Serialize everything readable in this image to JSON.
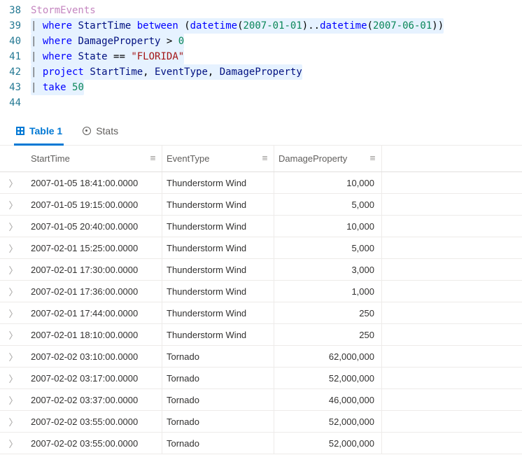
{
  "editor": {
    "lines": [
      {
        "num": 38,
        "highlight": false,
        "tokens": [
          {
            "t": "StormEvents",
            "c": "tk-src"
          }
        ]
      },
      {
        "num": 39,
        "highlight": true,
        "tokens": [
          {
            "t": "| ",
            "c": "tk-pipe"
          },
          {
            "t": "where",
            "c": "tk-op"
          },
          {
            "t": " ",
            "c": ""
          },
          {
            "t": "StartTime",
            "c": "tk-col"
          },
          {
            "t": " ",
            "c": ""
          },
          {
            "t": "between",
            "c": "tk-op"
          },
          {
            "t": " (",
            "c": "tk-paren"
          },
          {
            "t": "datetime",
            "c": "tk-fn"
          },
          {
            "t": "(",
            "c": "tk-paren"
          },
          {
            "t": "2007-01-01",
            "c": "tk-num"
          },
          {
            "t": ")..",
            "c": "tk-paren"
          },
          {
            "t": "datetime",
            "c": "tk-fn"
          },
          {
            "t": "(",
            "c": "tk-paren"
          },
          {
            "t": "2007-06-01",
            "c": "tk-num"
          },
          {
            "t": "))",
            "c": "tk-paren"
          }
        ]
      },
      {
        "num": 40,
        "highlight": true,
        "tokens": [
          {
            "t": "| ",
            "c": "tk-pipe"
          },
          {
            "t": "where",
            "c": "tk-op"
          },
          {
            "t": " ",
            "c": ""
          },
          {
            "t": "DamageProperty",
            "c": "tk-col"
          },
          {
            "t": " > ",
            "c": "tk-cmp"
          },
          {
            "t": "0",
            "c": "tk-num"
          }
        ]
      },
      {
        "num": 41,
        "highlight": true,
        "tokens": [
          {
            "t": "| ",
            "c": "tk-pipe"
          },
          {
            "t": "where",
            "c": "tk-op"
          },
          {
            "t": " ",
            "c": ""
          },
          {
            "t": "State",
            "c": "tk-col"
          },
          {
            "t": " == ",
            "c": "tk-cmp"
          },
          {
            "t": "\"FLORIDA\"",
            "c": "tk-str"
          }
        ]
      },
      {
        "num": 42,
        "highlight": true,
        "tokens": [
          {
            "t": "| ",
            "c": "tk-pipe"
          },
          {
            "t": "project",
            "c": "tk-op"
          },
          {
            "t": " ",
            "c": ""
          },
          {
            "t": "StartTime",
            "c": "tk-col"
          },
          {
            "t": ", ",
            "c": "tk-comma"
          },
          {
            "t": "EventType",
            "c": "tk-col"
          },
          {
            "t": ", ",
            "c": "tk-comma"
          },
          {
            "t": "DamageProperty",
            "c": "tk-col"
          }
        ]
      },
      {
        "num": 43,
        "highlight": true,
        "tokens": [
          {
            "t": "| ",
            "c": "tk-pipe"
          },
          {
            "t": "take",
            "c": "tk-op"
          },
          {
            "t": " ",
            "c": ""
          },
          {
            "t": "50",
            "c": "tk-num"
          }
        ]
      },
      {
        "num": 44,
        "highlight": false,
        "tokens": []
      }
    ]
  },
  "tabs": {
    "table": "Table 1",
    "stats": "Stats"
  },
  "columns": {
    "start": "StartTime",
    "event": "EventType",
    "damage": "DamageProperty"
  },
  "rows": [
    {
      "start": "2007-01-05 18:41:00.0000",
      "event": "Thunderstorm Wind",
      "damage": "10,000"
    },
    {
      "start": "2007-01-05 19:15:00.0000",
      "event": "Thunderstorm Wind",
      "damage": "5,000"
    },
    {
      "start": "2007-01-05 20:40:00.0000",
      "event": "Thunderstorm Wind",
      "damage": "10,000"
    },
    {
      "start": "2007-02-01 15:25:00.0000",
      "event": "Thunderstorm Wind",
      "damage": "5,000"
    },
    {
      "start": "2007-02-01 17:30:00.0000",
      "event": "Thunderstorm Wind",
      "damage": "3,000"
    },
    {
      "start": "2007-02-01 17:36:00.0000",
      "event": "Thunderstorm Wind",
      "damage": "1,000"
    },
    {
      "start": "2007-02-01 17:44:00.0000",
      "event": "Thunderstorm Wind",
      "damage": "250"
    },
    {
      "start": "2007-02-01 18:10:00.0000",
      "event": "Thunderstorm Wind",
      "damage": "250"
    },
    {
      "start": "2007-02-02 03:10:00.0000",
      "event": "Tornado",
      "damage": "62,000,000"
    },
    {
      "start": "2007-02-02 03:17:00.0000",
      "event": "Tornado",
      "damage": "52,000,000"
    },
    {
      "start": "2007-02-02 03:37:00.0000",
      "event": "Tornado",
      "damage": "46,000,000"
    },
    {
      "start": "2007-02-02 03:55:00.0000",
      "event": "Tornado",
      "damage": "52,000,000"
    },
    {
      "start": "2007-02-02 03:55:00.0000",
      "event": "Tornado",
      "damage": "52,000,000"
    }
  ],
  "icons": {
    "handle": "≡",
    "expand": "〉"
  }
}
